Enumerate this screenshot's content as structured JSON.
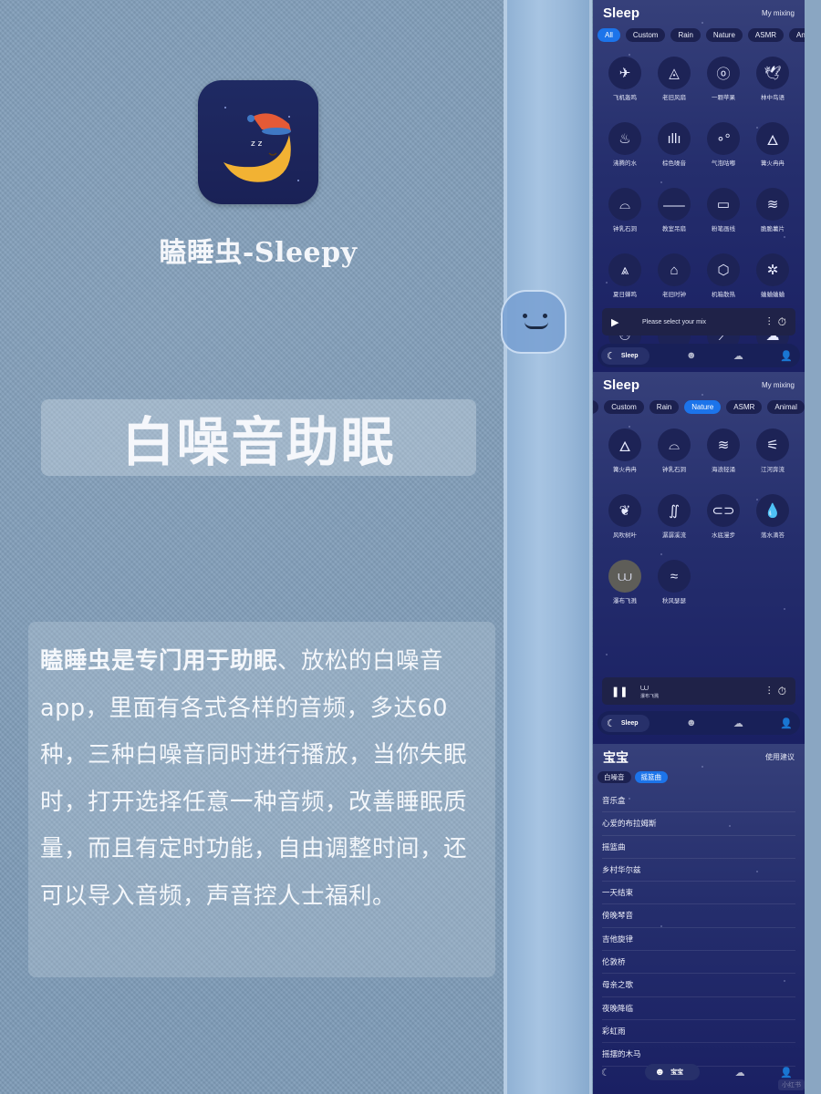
{
  "promo": {
    "app_name": "瞌睡虫-Sleepy",
    "headline": "白噪音助眠",
    "description_bold": "瞌睡虫是专门用于助眠",
    "description_rest": "、放松的白噪音app，里面有各式各样的音频，多达60种，三种白噪音同时进行播放，当你失眠时，打开选择任意一种音频，改善睡眠质量，而且有定时功能，自由调整时间，还可以导入音频，声音控人士福利。",
    "icon_name": "sleeping-moon-app-icon"
  },
  "screen_all": {
    "title": "Sleep",
    "link": "My mixing",
    "chips": [
      {
        "label": "All",
        "active": true
      },
      {
        "label": "Custom",
        "active": false
      },
      {
        "label": "Rain",
        "active": false
      },
      {
        "label": "Nature",
        "active": false
      },
      {
        "label": "ASMR",
        "active": false
      },
      {
        "label": "Animal",
        "active": false
      }
    ],
    "sounds": [
      {
        "label": "飞机轰鸣",
        "icon": "airplane-icon",
        "glyph": "✈"
      },
      {
        "label": "老旧风扇",
        "icon": "fan-icon",
        "glyph": "◬"
      },
      {
        "label": "一颗苹果",
        "icon": "apple-icon",
        "glyph": "ⓞ"
      },
      {
        "label": "林中鸟语",
        "icon": "bird-icon",
        "glyph": "🕊"
      },
      {
        "label": "沸腾的水",
        "icon": "boiling-pot-icon",
        "glyph": "♨"
      },
      {
        "label": "棕色噪音",
        "icon": "waveform-icon",
        "glyph": "ıllı"
      },
      {
        "label": "气泡咕嘟",
        "icon": "bubbles-icon",
        "glyph": "∘°"
      },
      {
        "label": "篝火冉冉",
        "icon": "fire-icon",
        "glyph": "🜂"
      },
      {
        "label": "钟乳石洞",
        "icon": "cave-icon",
        "glyph": "⌓"
      },
      {
        "label": "教室吊扇",
        "icon": "ceiling-fan-icon",
        "glyph": "⸺"
      },
      {
        "label": "粉笔画线",
        "icon": "chalkboard-icon",
        "glyph": "▭"
      },
      {
        "label": "脆脆薯片",
        "icon": "chips-icon",
        "glyph": "≋"
      },
      {
        "label": "夏日蝉鸣",
        "icon": "cicada-icon",
        "glyph": "⩓"
      },
      {
        "label": "老旧时钟",
        "icon": "clock-icon",
        "glyph": "⌂"
      },
      {
        "label": "机箱散热",
        "icon": "cpu-fan-icon",
        "glyph": "⬡"
      },
      {
        "label": "蛐蛐蛐蛐",
        "icon": "cricket-icon",
        "glyph": "✲"
      },
      {
        "label": "",
        "icon": "people-icon",
        "glyph": "⚇"
      },
      {
        "label": "",
        "icon": "cucumber-icon",
        "glyph": "⌒"
      },
      {
        "label": "",
        "icon": "knife-icon",
        "glyph": "⟋"
      },
      {
        "label": "",
        "icon": "rain-cloud-icon",
        "glyph": "☁"
      }
    ],
    "player": {
      "status": "Please select your mix"
    },
    "tabs": {
      "sleep": "Sleep"
    }
  },
  "screen_nature": {
    "title": "Sleep",
    "link": "My mixing",
    "chips": [
      {
        "label": "",
        "active": false
      },
      {
        "label": "Custom",
        "active": false
      },
      {
        "label": "Rain",
        "active": false
      },
      {
        "label": "Nature",
        "active": true
      },
      {
        "label": "ASMR",
        "active": false
      },
      {
        "label": "Animal",
        "active": false
      }
    ],
    "sounds": [
      {
        "label": "篝火冉冉",
        "icon": "fire-icon",
        "glyph": "🜂",
        "selected": false
      },
      {
        "label": "钟乳石洞",
        "icon": "cave-icon",
        "glyph": "⌓",
        "selected": false
      },
      {
        "label": "海浪轻涌",
        "icon": "waves-icon",
        "glyph": "≋",
        "selected": false
      },
      {
        "label": "江河奔流",
        "icon": "river-icon",
        "glyph": "⚟",
        "selected": false
      },
      {
        "label": "风吹树叶",
        "icon": "leaf-icon",
        "glyph": "❦",
        "selected": false
      },
      {
        "label": "潺潺溪流",
        "icon": "stream-icon",
        "glyph": "∬",
        "selected": false
      },
      {
        "label": "水底漫步",
        "icon": "diving-mask-icon",
        "glyph": "⊂⊃",
        "selected": false
      },
      {
        "label": "落水滴答",
        "icon": "water-drop-icon",
        "glyph": "💧",
        "selected": false
      },
      {
        "label": "瀑布飞溅",
        "icon": "waterfall-icon",
        "glyph": "⩊",
        "selected": true
      },
      {
        "label": "秋风瑟瑟",
        "icon": "wind-icon",
        "glyph": "≈",
        "selected": false
      }
    ],
    "player": {
      "now_playing": "瀑布飞溅"
    },
    "tabs": {
      "sleep": "Sleep"
    }
  },
  "screen_baby": {
    "title": "宝宝",
    "link": "使用建议",
    "chips": [
      {
        "label": "白噪音",
        "active": false
      },
      {
        "label": "摇篮曲",
        "active": true
      }
    ],
    "songs": [
      "音乐盒",
      "心爱的布拉姆斯",
      "摇篮曲",
      "乡村华尔兹",
      "一天结束",
      "傍晚琴音",
      "吉他旋律",
      "伦敦桥",
      "母亲之歌",
      "夜晚降临",
      "彩虹雨",
      "摇摆的木马"
    ],
    "tabs": {
      "baby": "宝宝"
    },
    "watermark": "小红书"
  },
  "colors": {
    "accent": "#1c74ea",
    "background": "#7f9cb8",
    "screen_bg": "#252e6d",
    "moon": "#f2b233",
    "hat": "#e55a36"
  }
}
